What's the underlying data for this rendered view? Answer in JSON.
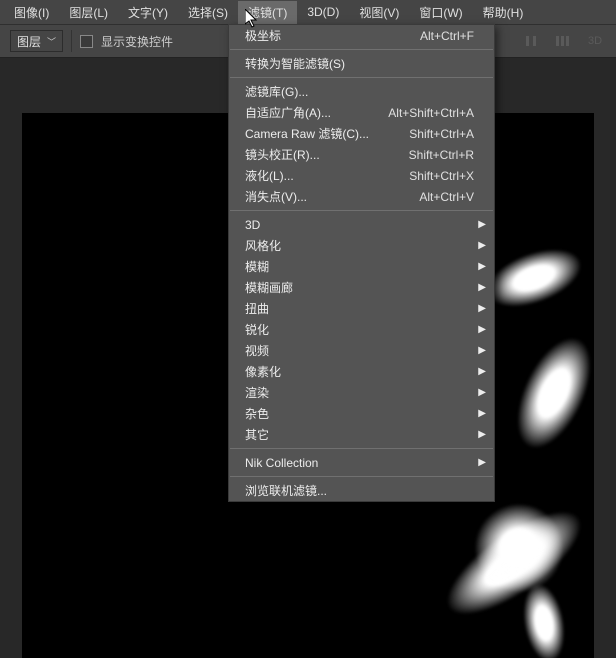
{
  "menubar": [
    {
      "label": "图像(I)"
    },
    {
      "label": "图层(L)"
    },
    {
      "label": "文字(Y)"
    },
    {
      "label": "选择(S)"
    },
    {
      "label": "滤镜(T)",
      "active": true
    },
    {
      "label": "3D(D)"
    },
    {
      "label": "视图(V)"
    },
    {
      "label": "窗口(W)"
    },
    {
      "label": "帮助(H)"
    }
  ],
  "toolbar": {
    "select_label": "图层",
    "checkbox_label": "显示变换控件",
    "right_icons": [
      "‖",
      "‖|",
      "3D"
    ]
  },
  "dropdown": {
    "sections": [
      [
        {
          "label": "极坐标",
          "shortcut": "Alt+Ctrl+F"
        }
      ],
      [
        {
          "label": "转换为智能滤镜(S)"
        }
      ],
      [
        {
          "label": "滤镜库(G)..."
        },
        {
          "label": "自适应广角(A)...",
          "shortcut": "Alt+Shift+Ctrl+A"
        },
        {
          "label": "Camera Raw 滤镜(C)...",
          "shortcut": "Shift+Ctrl+A"
        },
        {
          "label": "镜头校正(R)...",
          "shortcut": "Shift+Ctrl+R"
        },
        {
          "label": "液化(L)...",
          "shortcut": "Shift+Ctrl+X"
        },
        {
          "label": "消失点(V)...",
          "shortcut": "Alt+Ctrl+V"
        }
      ],
      [
        {
          "label": "3D",
          "submenu": true
        },
        {
          "label": "风格化",
          "submenu": true
        },
        {
          "label": "模糊",
          "submenu": true
        },
        {
          "label": "模糊画廊",
          "submenu": true
        },
        {
          "label": "扭曲",
          "submenu": true
        },
        {
          "label": "锐化",
          "submenu": true
        },
        {
          "label": "视频",
          "submenu": true
        },
        {
          "label": "像素化",
          "submenu": true
        },
        {
          "label": "渲染",
          "submenu": true
        },
        {
          "label": "杂色",
          "submenu": true
        },
        {
          "label": "其它",
          "submenu": true
        }
      ],
      [
        {
          "label": "Nik Collection",
          "submenu": true
        }
      ],
      [
        {
          "label": "浏览联机滤镜..."
        }
      ]
    ]
  }
}
